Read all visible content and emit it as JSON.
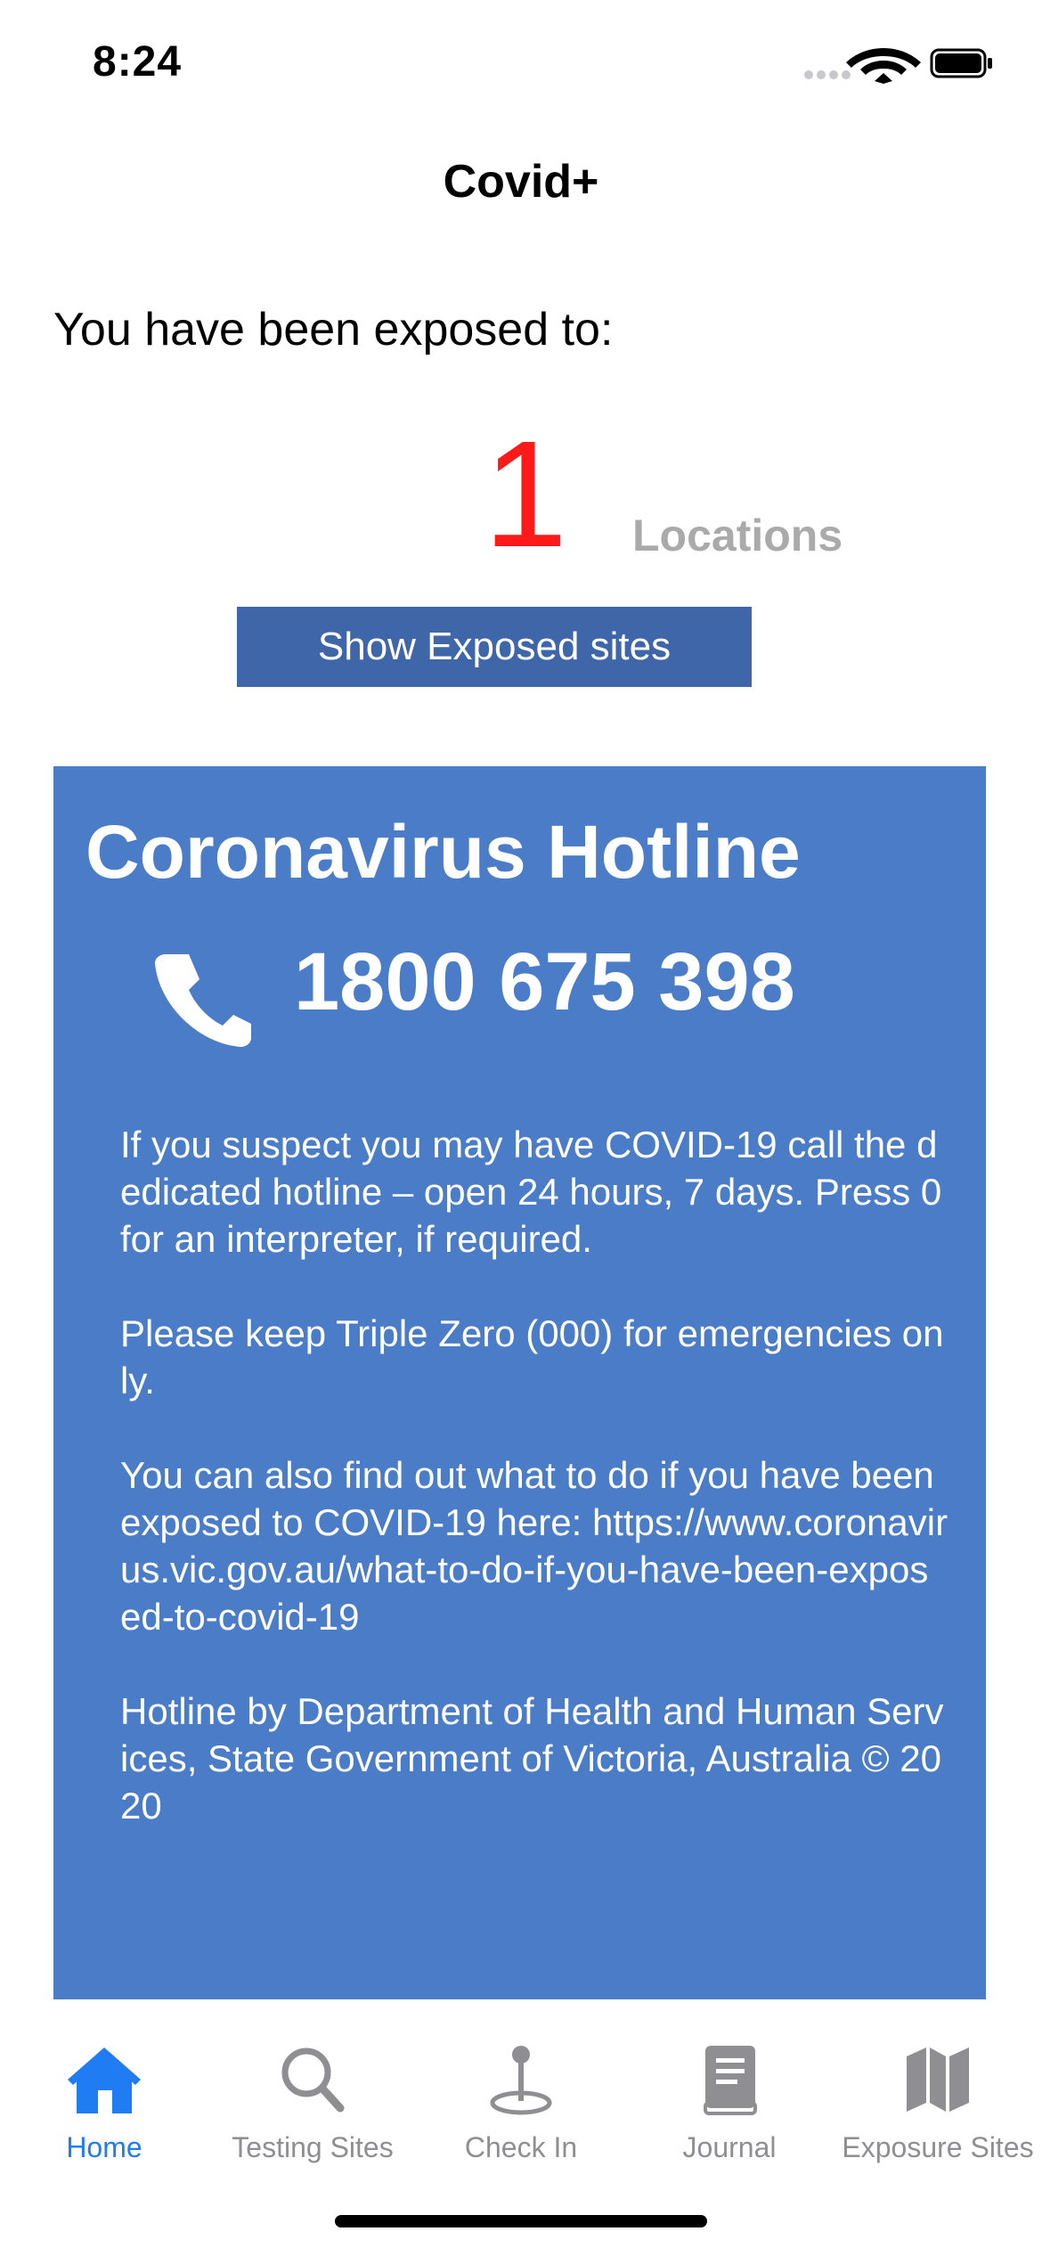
{
  "status_bar": {
    "time": "8:24"
  },
  "nav": {
    "title": "Covid+"
  },
  "exposure": {
    "label": "You have been exposed to:",
    "count": "1",
    "unit": "Locations",
    "button_label": "Show Exposed sites"
  },
  "hotline": {
    "title": "Coronavirus Hotline",
    "number": "1800 675 398",
    "paragraphs": [
      "If you suspect you may have COVID-19 call the dedicated hotline – open 24 hours, 7 days. Press 0 for an interpreter, if required.",
      "Please keep Triple Zero (000) for emergencies only.",
      "You can also find out what to do if you have been exposed to COVID-19 here: https://www.coronavirus.vic.gov.au/what-to-do-if-you-have-been-exposed-to-covid-19",
      "Hotline by Department of Health and Human Services, State Government of Victoria, Australia © 2020"
    ]
  },
  "tabs": [
    {
      "label": "Home",
      "icon": "house-icon",
      "active": true
    },
    {
      "label": "Testing Sites",
      "icon": "magnifier-icon",
      "active": false
    },
    {
      "label": "Check In",
      "icon": "map-pin-icon",
      "active": false
    },
    {
      "label": "Journal",
      "icon": "book-icon",
      "active": false
    },
    {
      "label": "Exposure Sites",
      "icon": "map-icon",
      "active": false
    }
  ],
  "colors": {
    "accent": "#1f7cf2",
    "count": "#ff1a1a",
    "panel": "#4a7cc7",
    "button": "#3f66a8",
    "inactive_tab": "#8e8e93"
  }
}
